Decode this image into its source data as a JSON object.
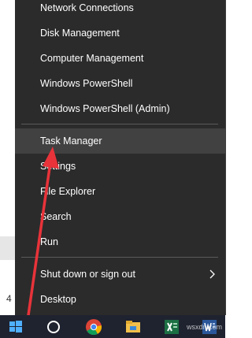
{
  "menu": {
    "items": [
      {
        "label": "Network Connections"
      },
      {
        "label": "Disk Management"
      },
      {
        "label": "Computer Management"
      },
      {
        "label": "Windows PowerShell"
      },
      {
        "label": "Windows PowerShell (Admin)"
      },
      {
        "label": "Task Manager"
      },
      {
        "label": "Settings"
      },
      {
        "label": "File Explorer"
      },
      {
        "label": "Search"
      },
      {
        "label": "Run"
      },
      {
        "label": "Shut down or sign out"
      },
      {
        "label": "Desktop"
      }
    ]
  },
  "background": {
    "left_mark": "4"
  },
  "taskbar": {
    "icons": [
      "windows-start-icon",
      "cortana-icon",
      "chrome-icon",
      "file-explorer-icon",
      "excel-icon",
      "word-icon"
    ]
  },
  "watermark": "wsxdn.com",
  "colors": {
    "menu_bg": "#2b2b2b",
    "highlight": "#414141",
    "arrow": "#e8333a",
    "taskbar": "#1f2330"
  }
}
